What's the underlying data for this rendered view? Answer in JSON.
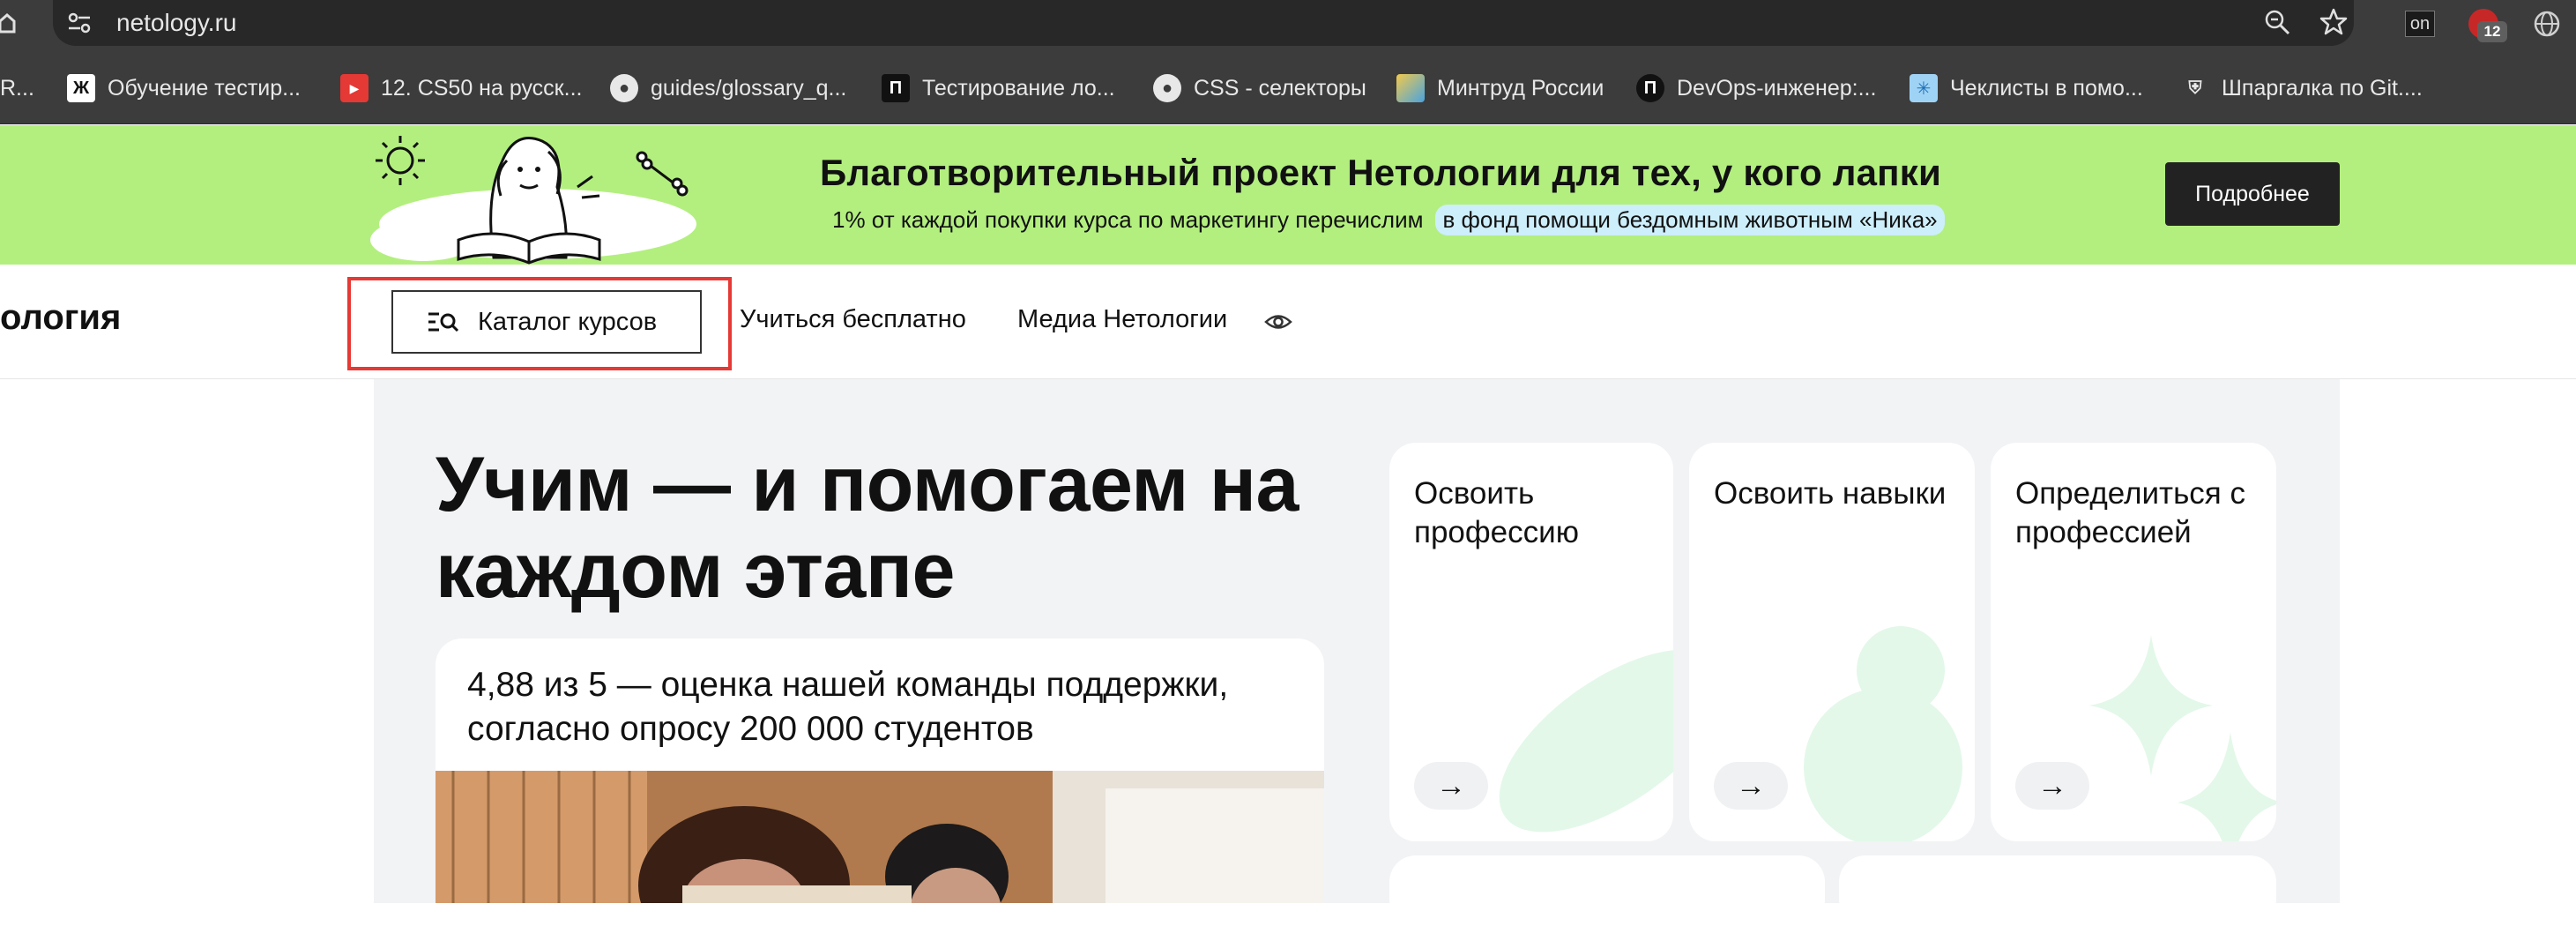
{
  "browser": {
    "url": "netology.ru",
    "extension_label": "on",
    "extension_badge": "12",
    "bookmarks": [
      {
        "label": "R...",
        "icon": ""
      },
      {
        "label": "Обучение тестир...",
        "icon": "Ж"
      },
      {
        "label": "12. CS50 на русск...",
        "icon": "▶"
      },
      {
        "label": "guides/glossary_q...",
        "icon": "●"
      },
      {
        "label": "Тестирование ло...",
        "icon": "Π"
      },
      {
        "label": "CSS - селекторы",
        "icon": "●"
      },
      {
        "label": "Минтруд России",
        "icon": ""
      },
      {
        "label": "DevOps-инженер:...",
        "icon": "Π"
      },
      {
        "label": "Чеклисты в помо...",
        "icon": "✳"
      },
      {
        "label": "Шпаргалка по Git....",
        "icon": "⛨"
      }
    ]
  },
  "promo": {
    "title": "Благотворительный проект Нетологии для тех, у кого лапки",
    "subtitle": "1% от каждой покупки курса по маркетингу перечислим",
    "highlight": "в фонд помощи бездомным животным «Ника»",
    "button": "Подробнее"
  },
  "header": {
    "logo": "ология",
    "catalog_button": "Каталог курсов",
    "nav": [
      "Учиться бесплатно",
      "Медиа Нетологии"
    ]
  },
  "hero": {
    "title": "Учим — и помогаем на каждом этапе",
    "support_text": "4,88 из 5 — оценка нашей команды поддержки, согласно опросу 200 000 студентов"
  },
  "cards": [
    {
      "title": "Освоить профессию",
      "arrow": "→"
    },
    {
      "title": "Освоить навыки",
      "arrow": "→"
    },
    {
      "title": "Определиться с профессией",
      "arrow": "→"
    }
  ],
  "colors": {
    "promo_bg": "#b3ef7f",
    "highlight_border": "#e53935",
    "main_bg": "#f2f3f5",
    "deco_green": "#e3f8e9"
  }
}
